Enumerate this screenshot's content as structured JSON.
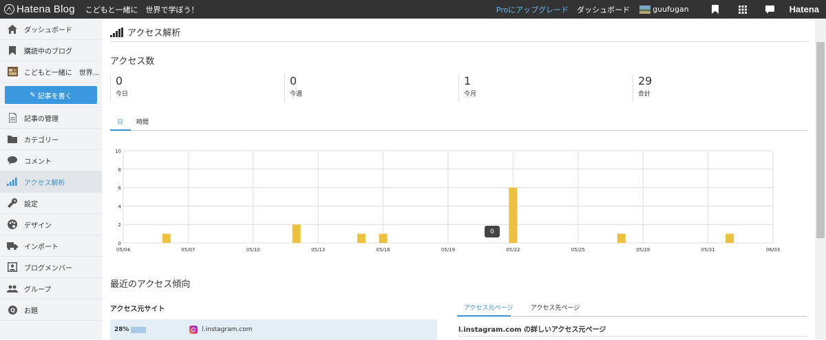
{
  "header": {
    "logo": "Hatena Blog",
    "blog_title": "こどもと一緒に　世界で学ぼう！",
    "pro_link": "Proにアップグレード",
    "dashboard_link": "ダッシュボード",
    "username": "guufugan",
    "hatena": "Hatena"
  },
  "sidebar": {
    "items": [
      {
        "label": "ダッシュボード",
        "icon": "home-icon"
      },
      {
        "label": "購読中のブログ",
        "icon": "bookmark-icon"
      },
      {
        "label": "こどもと一緒に　世界...",
        "icon": "blog-thumbnail-icon"
      },
      {
        "label": "記事の管理",
        "icon": "document-icon"
      },
      {
        "label": "カテゴリー",
        "icon": "folder-icon"
      },
      {
        "label": "コメント",
        "icon": "comment-icon"
      },
      {
        "label": "アクセス解析",
        "icon": "bar-chart-icon"
      },
      {
        "label": "設定",
        "icon": "wrench-icon"
      },
      {
        "label": "デザイン",
        "icon": "palette-icon"
      },
      {
        "label": "インポート",
        "icon": "truck-icon"
      },
      {
        "label": "ブログメンバー",
        "icon": "members-icon"
      },
      {
        "label": "グループ",
        "icon": "group-icon"
      },
      {
        "label": "お題",
        "icon": "topic-icon"
      }
    ],
    "write_button": "記事を書く",
    "active_index": 6
  },
  "main": {
    "page_title": "アクセス解析",
    "access_section_title": "アクセス数",
    "stats": [
      {
        "value": "0",
        "label": "今日"
      },
      {
        "value": "0",
        "label": "今週"
      },
      {
        "value": "1",
        "label": "今月"
      },
      {
        "value": "29",
        "label": "合計"
      }
    ],
    "tabs": [
      {
        "label": "日",
        "active": true
      },
      {
        "label": "時間",
        "active": false
      }
    ],
    "tooltip": "0",
    "trend_title": "最近のアクセス傾向",
    "source_sites_title": "アクセス元サイト",
    "source_rows": [
      {
        "percent": "28%",
        "percent_value": 28,
        "site": "l.instagram.com"
      }
    ],
    "page_tabs": [
      {
        "label": "アクセス元ページ",
        "active": true
      },
      {
        "label": "アクセス先ページ",
        "active": false
      }
    ],
    "detail_title": "l.instagram.com の詳しいアクセス元ページ"
  },
  "chart_data": {
    "type": "bar",
    "x_tick_labels": [
      "05/04",
      "05/07",
      "05/10",
      "05/13",
      "05/16",
      "05/19",
      "05/22",
      "05/25",
      "05/28",
      "05/31",
      "06/03"
    ],
    "y_tick_labels": [
      "0",
      "2",
      "4",
      "6",
      "8",
      "10"
    ],
    "ylim": [
      0,
      10
    ],
    "categories": [
      "05/04",
      "05/05",
      "05/06",
      "05/07",
      "05/08",
      "05/09",
      "05/10",
      "05/11",
      "05/12",
      "05/13",
      "05/14",
      "05/15",
      "05/16",
      "05/17",
      "05/18",
      "05/19",
      "05/20",
      "05/21",
      "05/22",
      "05/23",
      "05/24",
      "05/25",
      "05/26",
      "05/27",
      "05/28",
      "05/29",
      "05/30",
      "05/31",
      "06/01",
      "06/02",
      "06/03"
    ],
    "values": [
      0,
      0,
      1,
      0,
      0,
      0,
      0,
      0,
      2,
      0,
      0,
      1,
      1,
      0,
      0,
      0,
      0,
      0,
      6,
      0,
      0,
      0,
      0,
      1,
      0,
      0,
      0,
      0,
      1,
      0,
      0
    ],
    "bar_color": "#ecc13f",
    "grid": true
  },
  "colors": {
    "accent": "#3a8fd1",
    "topbar": "#333333",
    "bar": "#ecc13f"
  }
}
